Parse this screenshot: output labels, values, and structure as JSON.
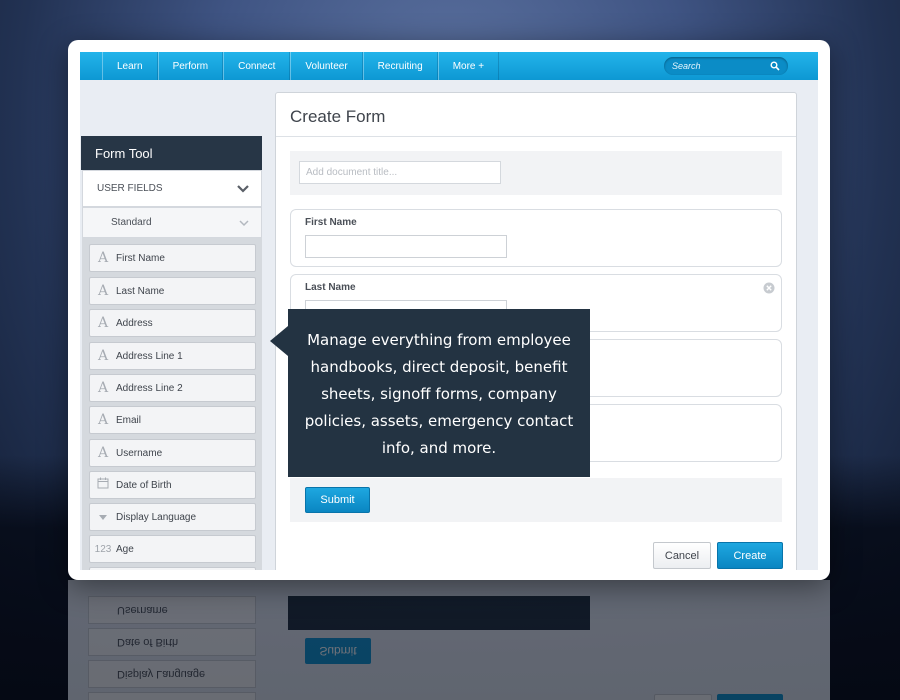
{
  "nav": {
    "items": [
      "Learn",
      "Perform",
      "Connect",
      "Volunteer",
      "Recruiting",
      "More +"
    ],
    "search_placeholder": "Search"
  },
  "sidebar": {
    "title": "Form Tool",
    "section": "USER FIELDS",
    "subsection": "Standard",
    "items": [
      {
        "icon": "text-icon",
        "glyph": "A",
        "label": "First Name"
      },
      {
        "icon": "text-icon",
        "glyph": "A",
        "label": "Last Name"
      },
      {
        "icon": "text-icon",
        "glyph": "A",
        "label": "Address"
      },
      {
        "icon": "text-icon",
        "glyph": "A",
        "label": "Address Line 1"
      },
      {
        "icon": "text-icon",
        "glyph": "A",
        "label": "Address Line 2"
      },
      {
        "icon": "text-icon",
        "glyph": "A",
        "label": "Email"
      },
      {
        "icon": "text-icon",
        "glyph": "A",
        "label": "Username"
      },
      {
        "icon": "calendar-icon",
        "glyph": "",
        "label": "Date of Birth"
      },
      {
        "icon": "dropdown-icon",
        "glyph": "",
        "label": "Display Language"
      },
      {
        "icon": "number-icon",
        "glyph": "123",
        "label": "Age"
      }
    ]
  },
  "form": {
    "title": "Create Form",
    "doc_title_placeholder": "Add document title...",
    "fields": [
      {
        "label": "First Name"
      },
      {
        "label": "Last Name"
      },
      {
        "label": ""
      },
      {
        "label": ""
      }
    ],
    "submit_label": "Submit",
    "cancel_label": "Cancel",
    "create_label": "Create"
  },
  "callout": {
    "text": "Manage everything from employee handbooks, direct deposit, benefit sheets, signoff forms, company policies, assets, emergency contact info, and more."
  },
  "colors": {
    "nav_blue": "#14a6e0",
    "dark_navy": "#273646",
    "button_blue": "#0f93cf"
  }
}
